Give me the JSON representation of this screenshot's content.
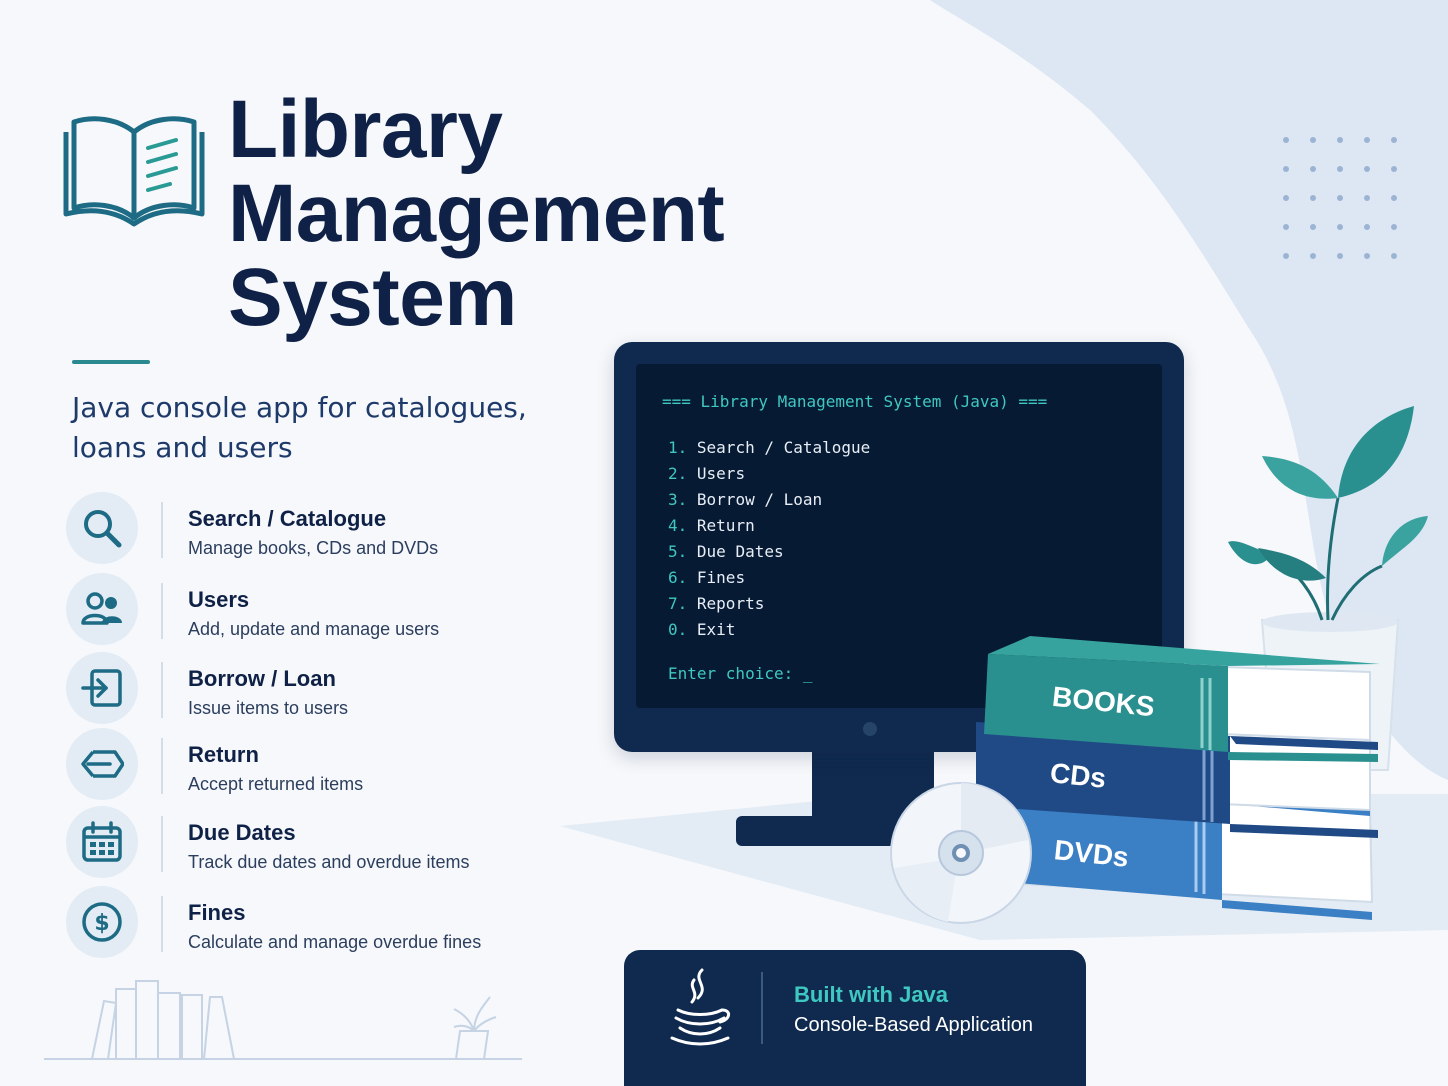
{
  "header": {
    "title_lines": [
      "Library",
      "Management",
      "System"
    ],
    "subtitle": "Java console app for catalogues, loans and users"
  },
  "features": [
    {
      "title": "Search / Catalogue",
      "desc": "Manage books, CDs and DVDs",
      "icon": "search-icon"
    },
    {
      "title": "Users",
      "desc": "Add, update and manage users",
      "icon": "users-icon"
    },
    {
      "title": "Borrow / Loan",
      "desc": "Issue items to users",
      "icon": "borrow-icon"
    },
    {
      "title": "Return",
      "desc": "Accept returned items",
      "icon": "return-icon"
    },
    {
      "title": "Due Dates",
      "desc": "Track due dates and overdue items",
      "icon": "calendar-icon"
    },
    {
      "title": "Fines",
      "desc": "Calculate and manage overdue fines",
      "icon": "dollar-icon"
    }
  ],
  "terminal": {
    "header": "=== Library Management System (Java) ===",
    "menu": [
      {
        "num": "1.",
        "label": "Search / Catalogue"
      },
      {
        "num": "2.",
        "label": "Users"
      },
      {
        "num": "3.",
        "label": "Borrow / Loan"
      },
      {
        "num": "4.",
        "label": "Return"
      },
      {
        "num": "5.",
        "label": "Due Dates"
      },
      {
        "num": "6.",
        "label": "Fines"
      },
      {
        "num": "7.",
        "label": "Reports"
      },
      {
        "num": "0.",
        "label": "Exit"
      }
    ],
    "prompt": "Enter choice: _"
  },
  "books": {
    "labels": [
      "BOOKS",
      "CDs",
      "DVDs"
    ],
    "colors": [
      "#2a8f8f",
      "#1f4a86",
      "#3b7fc4"
    ]
  },
  "footer": {
    "line1": "Built with Java",
    "line2": "Console-Based Application"
  },
  "colors": {
    "navy": "#0f2146",
    "teal": "#2a8a8f",
    "terminal_bg": "#071a33",
    "terminal_accent": "#3fc8c1",
    "page_bg": "#f6f8fb",
    "blob": "#dde8f4"
  }
}
